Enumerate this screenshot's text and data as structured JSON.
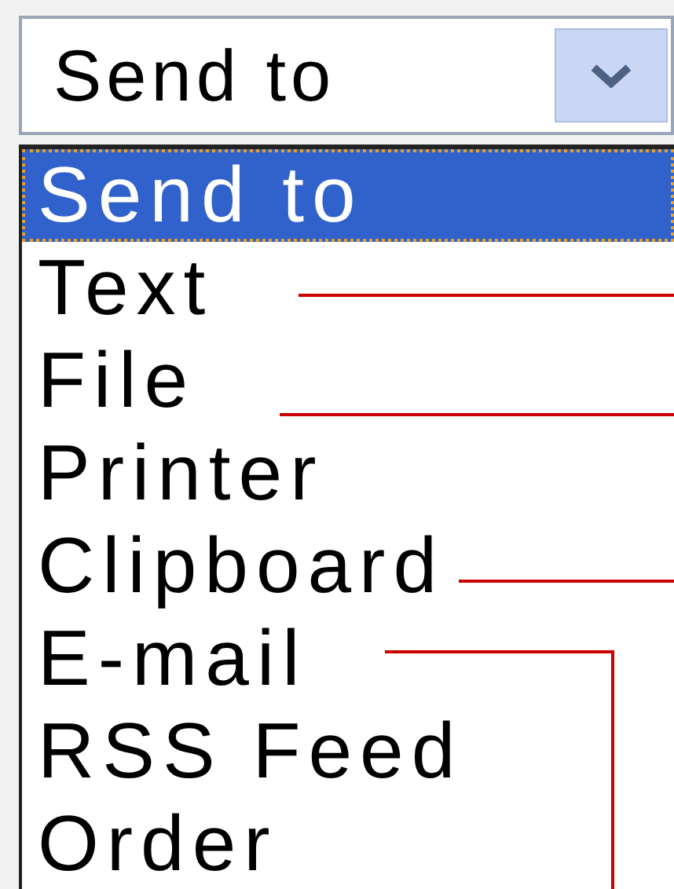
{
  "combo": {
    "value": "Send to"
  },
  "options": [
    {
      "label": "Send to",
      "selected": true
    },
    {
      "label": "Text",
      "selected": false
    },
    {
      "label": "File",
      "selected": false
    },
    {
      "label": "Printer",
      "selected": false
    },
    {
      "label": "Clipboard",
      "selected": false
    },
    {
      "label": "E-mail",
      "selected": false
    },
    {
      "label": "RSS Feed",
      "selected": false
    },
    {
      "label": "Order",
      "selected": false
    }
  ]
}
